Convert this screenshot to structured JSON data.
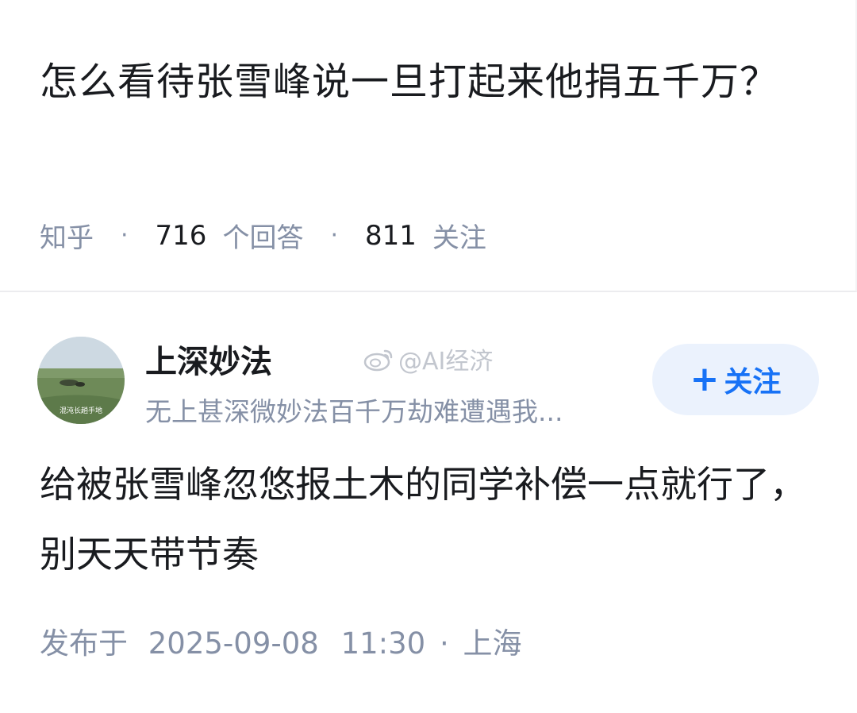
{
  "question": {
    "title": "怎么看待张雪峰说一旦打起来他捐五千万？",
    "source": "知乎",
    "answers_count": "716",
    "answers_label": "个回答",
    "followers_count": "811",
    "followers_label": "关注",
    "separator": "·"
  },
  "answer": {
    "author": {
      "name": "上深妙法",
      "bio": "无上甚深微妙法百千万劫难遭遇我...",
      "avatar_caption": "混沌长趟手地"
    },
    "watermark": "@AI经济",
    "follow_button": {
      "icon": "+",
      "label": "关注"
    },
    "content": "给被张雪峰忽悠报土木的同学补偿一点就行了，别天天带节奏",
    "published_label": "发布于",
    "published_date": "2025-09-08",
    "published_time": "11:30",
    "location_separator": "·",
    "location": "上海"
  },
  "colors": {
    "accent": "#1772f6",
    "follow_bg": "#ebf2fd",
    "meta_text": "#8590a6",
    "primary_text": "#191b1f"
  }
}
